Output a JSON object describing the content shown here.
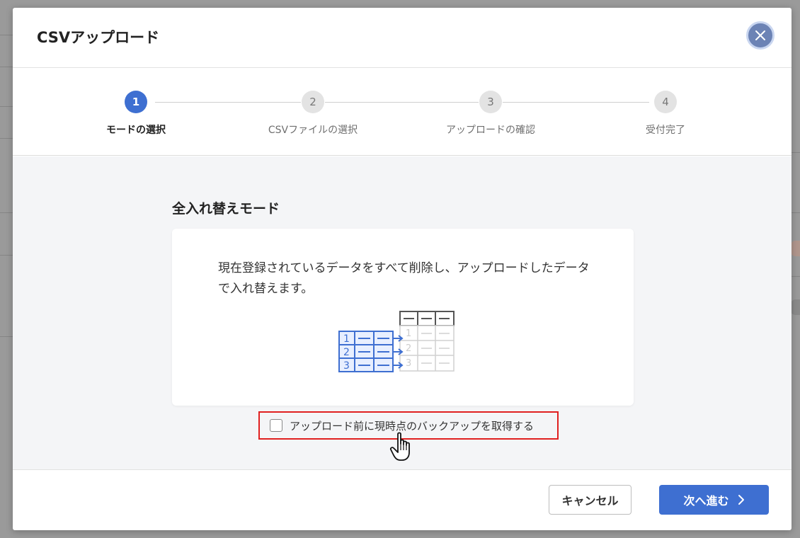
{
  "modal": {
    "title": "CSVアップロード"
  },
  "stepper": {
    "steps": [
      {
        "number": "1",
        "label": "モードの選択",
        "active": true
      },
      {
        "number": "2",
        "label": "CSVファイルの選択",
        "active": false
      },
      {
        "number": "3",
        "label": "アップロードの確認",
        "active": false
      },
      {
        "number": "4",
        "label": "受付完了",
        "active": false
      }
    ]
  },
  "mode": {
    "title": "全入れ替えモード",
    "description": "現在登録されているデータをすべて削除し、アップロードしたデータで入れ替えます。",
    "illustration_rows": [
      "1",
      "2",
      "3"
    ]
  },
  "backup": {
    "label": "アップロード前に現時点のバックアップを取得する",
    "checked": false
  },
  "footer": {
    "cancel_label": "キャンセル",
    "next_label": "次へ進む",
    "next_icon": "chevron-right-icon"
  },
  "colors": {
    "accent": "#3e6fd1",
    "highlight": "#e02020"
  }
}
